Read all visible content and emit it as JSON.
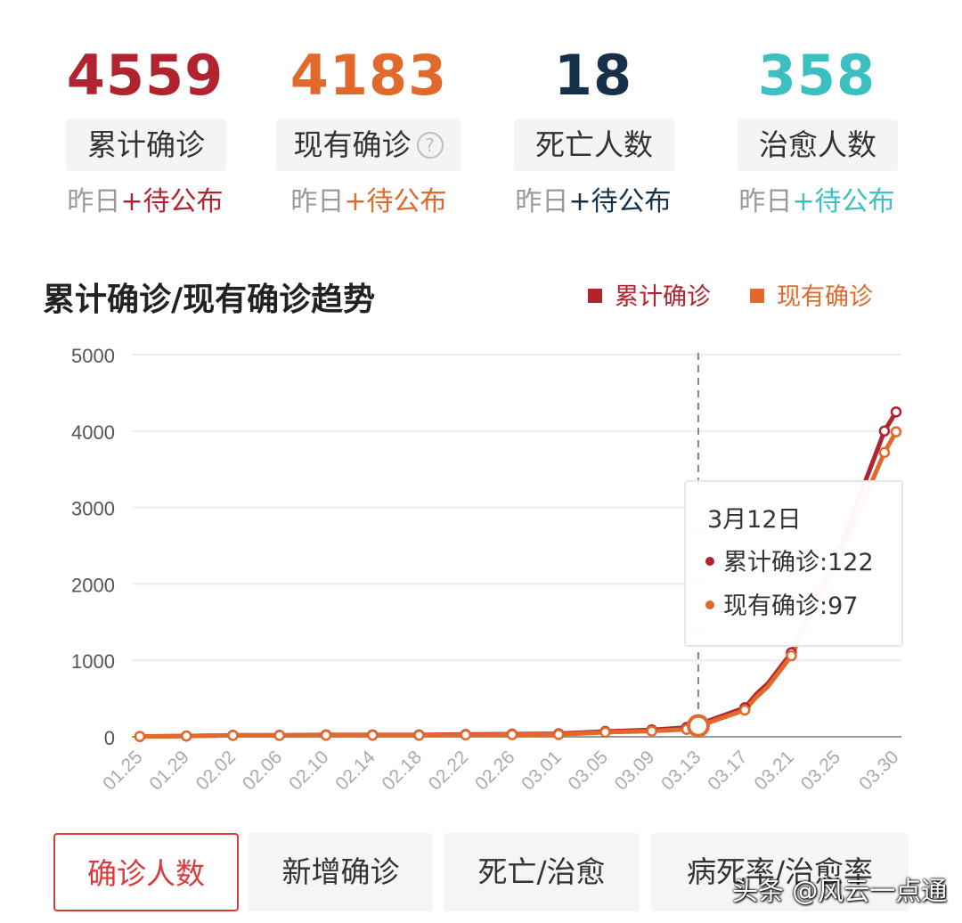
{
  "stats": [
    {
      "value": "4559",
      "label": "累计确诊",
      "yesterday_prefix": "昨日",
      "yesterday_value": "+待公布",
      "color": "#b22330"
    },
    {
      "value": "4183",
      "label": "现有确诊",
      "yesterday_prefix": "昨日",
      "yesterday_value": "+待公布",
      "color": "#e0692b",
      "help_icon": "?"
    },
    {
      "value": "18",
      "label": "死亡人数",
      "yesterday_prefix": "昨日",
      "yesterday_value": "+待公布",
      "color": "#16304a"
    },
    {
      "value": "358",
      "label": "治愈人数",
      "yesterday_prefix": "昨日",
      "yesterday_value": "+待公布",
      "color": "#3cbfc0"
    }
  ],
  "chart_title": "累计确诊/现有确诊趋势",
  "legend": [
    {
      "name": "累计确诊",
      "color": "#b22330"
    },
    {
      "name": "现有确诊",
      "color": "#e0692b"
    }
  ],
  "tooltip": {
    "date": "3月12日",
    "rows": [
      {
        "label": "累计确诊:122",
        "color": "#b22330"
      },
      {
        "label": "现有确诊:97",
        "color": "#e0692b"
      }
    ]
  },
  "tabs": [
    {
      "label": "确诊人数",
      "active": true
    },
    {
      "label": "新增确诊",
      "active": false
    },
    {
      "label": "死亡/治愈",
      "active": false
    },
    {
      "label": "病死率/治愈率",
      "active": false
    }
  ],
  "watermark": "头条 @风云一点通",
  "chart_data": {
    "type": "line",
    "ylim": [
      0,
      5000
    ],
    "yticks": [
      0,
      1000,
      2000,
      3000,
      4000,
      5000
    ],
    "xtick_labels": [
      "01.25",
      "01.29",
      "02.02",
      "02.06",
      "02.10",
      "02.14",
      "02.18",
      "02.22",
      "02.26",
      "03.01",
      "03.05",
      "03.09",
      "03.13",
      "03.17",
      "03.21",
      "03.25",
      "03.30"
    ],
    "highlight_label": "03.13",
    "series": [
      {
        "name": "累计确诊",
        "color": "#b22330",
        "points": [
          [
            "01.25",
            5
          ],
          [
            "01.29",
            10
          ],
          [
            "02.02",
            20
          ],
          [
            "02.06",
            20
          ],
          [
            "02.10",
            25
          ],
          [
            "02.14",
            25
          ],
          [
            "02.18",
            25
          ],
          [
            "02.22",
            30
          ],
          [
            "02.26",
            35
          ],
          [
            "03.01",
            40
          ],
          [
            "03.05",
            70
          ],
          [
            "03.09",
            90
          ],
          [
            "03.12",
            122
          ],
          [
            "03.13",
            160
          ],
          [
            "03.17",
            380
          ],
          [
            "03.18",
            560
          ],
          [
            "03.19",
            700
          ],
          [
            "03.21",
            1100
          ],
          [
            "03.25",
            2400
          ],
          [
            "03.29",
            4000
          ],
          [
            "03.30",
            4250
          ]
        ]
      },
      {
        "name": "现有确诊",
        "color": "#e0692b",
        "points": [
          [
            "01.25",
            5
          ],
          [
            "01.29",
            10
          ],
          [
            "02.02",
            18
          ],
          [
            "02.06",
            18
          ],
          [
            "02.10",
            20
          ],
          [
            "02.14",
            20
          ],
          [
            "02.18",
            20
          ],
          [
            "02.22",
            25
          ],
          [
            "02.26",
            28
          ],
          [
            "03.01",
            30
          ],
          [
            "03.05",
            60
          ],
          [
            "03.09",
            75
          ],
          [
            "03.12",
            97
          ],
          [
            "03.13",
            140
          ],
          [
            "03.17",
            350
          ],
          [
            "03.18",
            520
          ],
          [
            "03.19",
            660
          ],
          [
            "03.21",
            1060
          ],
          [
            "03.25",
            2300
          ],
          [
            "03.29",
            3720
          ],
          [
            "03.30",
            3990
          ]
        ]
      }
    ]
  }
}
